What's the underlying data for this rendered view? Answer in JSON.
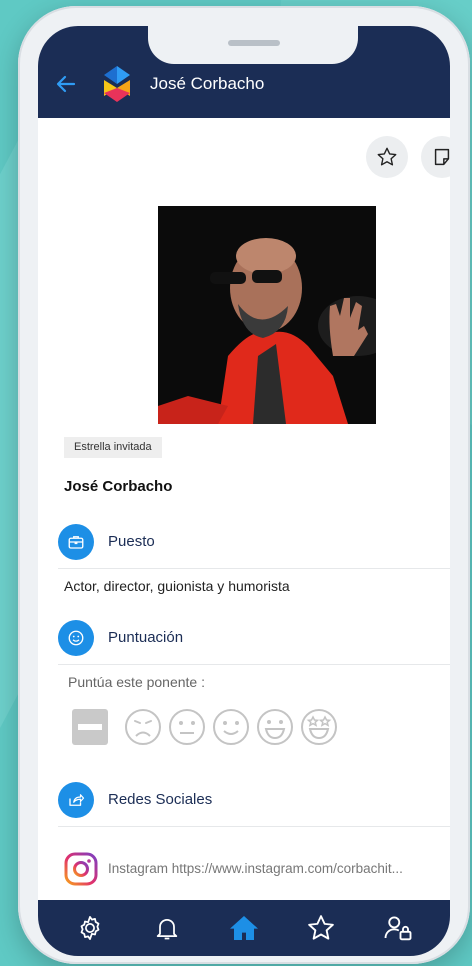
{
  "app": {
    "title": "José Corbacho"
  },
  "colors": {
    "navy": "#1b2d55",
    "accent": "#1d8fe6",
    "background": "#5fc9c4"
  },
  "toolbar": {
    "favorite_icon": "star-outline-icon",
    "note_icon": "sticky-note-icon"
  },
  "speaker": {
    "photo": "portrait-photo",
    "badge": "Estrella invitada",
    "name": "José Corbacho"
  },
  "sections": {
    "position": {
      "label": "Puesto",
      "icon": "briefcase-icon",
      "value": "Actor, director, guionista y humorista"
    },
    "rating": {
      "label": "Puntuación",
      "icon": "smiley-icon",
      "prompt": "Puntúa este ponente :",
      "options": [
        "no-rating",
        "very-sad",
        "neutral",
        "smile",
        "happy",
        "star-eyes"
      ]
    },
    "social": {
      "label": "Redes Sociales",
      "icon": "share-icon",
      "links": [
        {
          "icon": "instagram-icon",
          "text": "Instagram https://www.instagram.com/corbachit..."
        }
      ]
    }
  },
  "tabbar": {
    "items": [
      "settings-icon",
      "bell-icon",
      "home-icon",
      "star-icon",
      "user-lock-icon"
    ],
    "active": "home-icon"
  }
}
